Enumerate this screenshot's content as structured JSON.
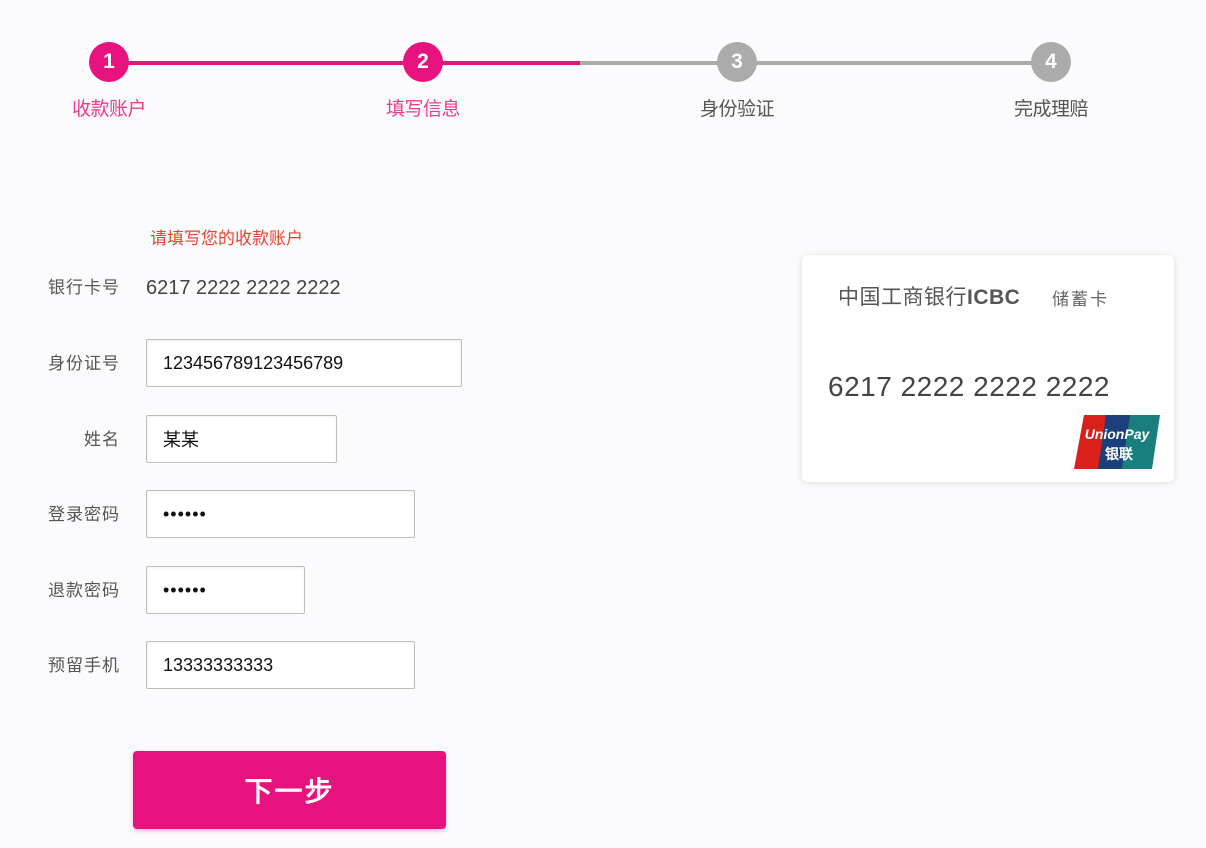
{
  "stepper": {
    "steps": [
      {
        "number": "1",
        "label": "收款账户",
        "state": "done"
      },
      {
        "number": "2",
        "label": "填写信息",
        "state": "done"
      },
      {
        "number": "3",
        "label": "身份验证",
        "state": "todo"
      },
      {
        "number": "4",
        "label": "完成理赔",
        "state": "todo"
      }
    ],
    "colors": {
      "active": "#e8127f",
      "inactive": "#ababab"
    }
  },
  "form": {
    "hint": "请填写您的收款账户",
    "card_number": {
      "label": "银行卡号",
      "value": "6217 2222 2222 2222"
    },
    "id_number": {
      "label": "身份证号",
      "value": "123456789123456789"
    },
    "name": {
      "label": "姓名",
      "value": "某某"
    },
    "login_password": {
      "label": "登录密码",
      "value": "••••••"
    },
    "refund_password": {
      "label": "退款密码",
      "value": "••••••"
    },
    "phone": {
      "label": "预留手机",
      "value": "13333333333"
    },
    "next_button": "下一步"
  },
  "card": {
    "bank_name": "中国工商银行",
    "bank_abbr": "ICBC",
    "card_type": "储蓄卡",
    "number": "6217 2222 2222 2222",
    "network_logo": "unionpay-logo",
    "network_logo_text": "UnionPay",
    "network_logo_text_cn": "银联"
  }
}
